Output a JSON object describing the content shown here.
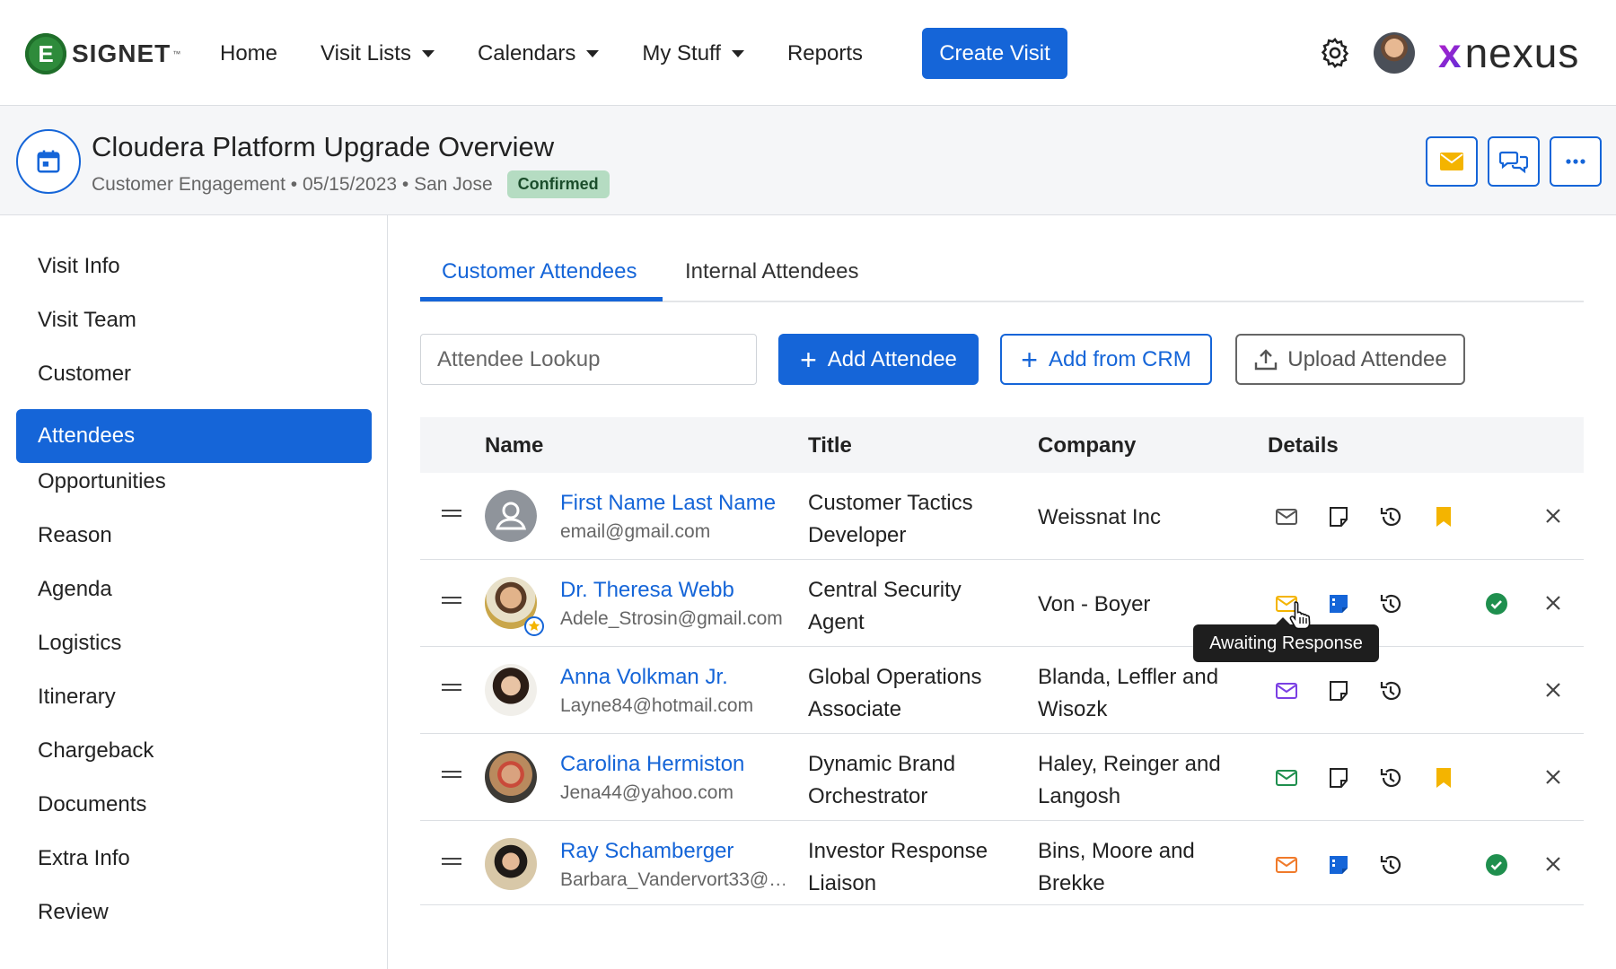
{
  "brand": {
    "logo_letter": "E",
    "logo_name": "SIGNET",
    "logo_tm": "™",
    "partner_prefix": "x",
    "partner_name": "nexus"
  },
  "nav": {
    "items": [
      {
        "label": "Home",
        "dropdown": false
      },
      {
        "label": "Visit Lists",
        "dropdown": true
      },
      {
        "label": "Calendars",
        "dropdown": true
      },
      {
        "label": "My Stuff",
        "dropdown": true
      },
      {
        "label": "Reports",
        "dropdown": false
      }
    ],
    "create_label": "Create Visit"
  },
  "visit": {
    "title": "Cloudera Platform Upgrade Overview",
    "meta": "Customer Engagement • 05/15/2023 • San Jose",
    "status": "Confirmed"
  },
  "sidebar": {
    "items": [
      {
        "label": "Visit Info"
      },
      {
        "label": "Visit Team"
      },
      {
        "label": "Customer"
      },
      {
        "label": "Attendees",
        "active": true
      },
      {
        "label": "Opportunities"
      },
      {
        "label": "Reason"
      },
      {
        "label": "Agenda"
      },
      {
        "label": "Logistics"
      },
      {
        "label": "Itinerary"
      },
      {
        "label": "Chargeback"
      },
      {
        "label": "Documents"
      },
      {
        "label": "Extra Info"
      },
      {
        "label": "Review"
      }
    ]
  },
  "tabs": [
    {
      "label": "Customer Attendees",
      "active": true
    },
    {
      "label": "Internal Attendees"
    }
  ],
  "actions": {
    "lookup_placeholder": "Attendee Lookup",
    "add_attendee": "Add Attendee",
    "add_from_crm": "Add from CRM",
    "upload_attendee": "Upload Attendee"
  },
  "table": {
    "headers": {
      "name": "Name",
      "title": "Title",
      "company": "Company",
      "details": "Details"
    },
    "rows": [
      {
        "name": "First Name Last Name",
        "email": "email@gmail.com",
        "title": "Customer Tactics Developer",
        "company": "Weissnat Inc"
      },
      {
        "name": "Dr. Theresa Webb",
        "email": "Adele_Strosin@gmail.com",
        "title": "Central Security Agent",
        "company": "Von - Boyer"
      },
      {
        "name": "Anna Volkman Jr.",
        "email": "Layne84@hotmail.com",
        "title": "Global Operations Associate",
        "company": "Blanda, Leffler and Wisozk"
      },
      {
        "name": "Carolina Hermiston",
        "email": "Jena44@yahoo.com",
        "title": "Dynamic Brand Orchestrator",
        "company": "Haley, Reinger and Langosh"
      },
      {
        "name": "Ray Schamberger",
        "email": "Barbara_Vandervort33@…",
        "title": "Investor Response Liaison",
        "company": "Bins, Moore and Brekke"
      }
    ]
  },
  "tooltip": "Awaiting Response",
  "colors": {
    "primary": "#1565d8",
    "mail_yellow": "#f4b400",
    "mail_orange": "#f07a2a",
    "mail_purple": "#7b3fe4",
    "mail_green": "#1f8f4e",
    "check_green": "#1f8f4e",
    "bookmark": "#f4b400"
  }
}
